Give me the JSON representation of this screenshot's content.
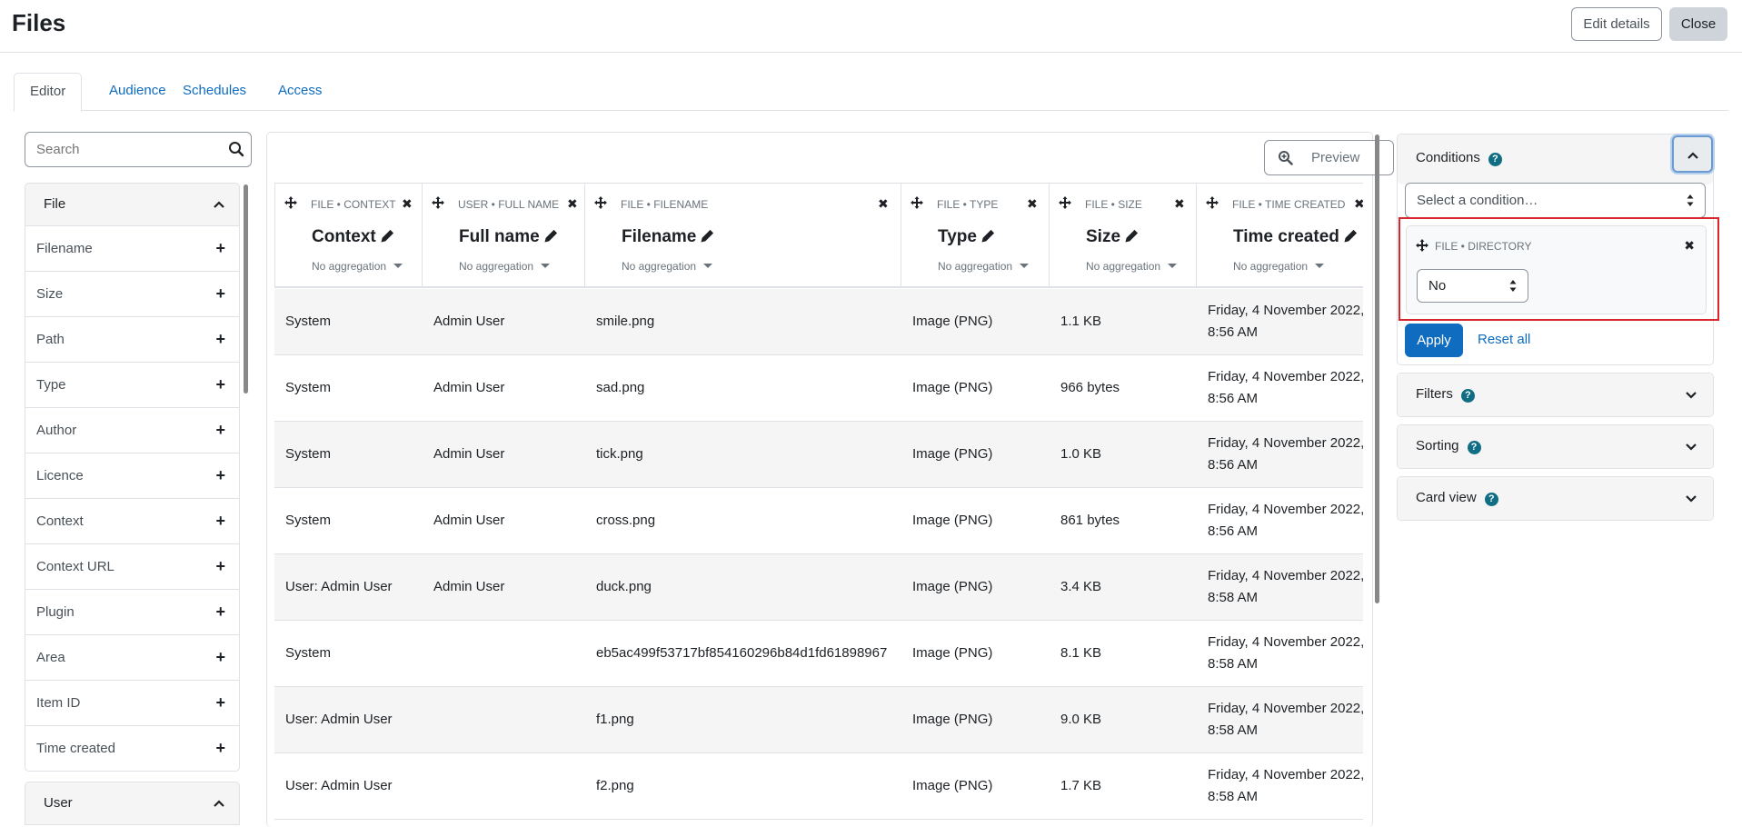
{
  "header": {
    "title": "Files",
    "edit_details_label": "Edit details",
    "close_label": "Close"
  },
  "tabs": [
    {
      "label": "Editor",
      "active": true
    },
    {
      "label": "Audience",
      "active": false
    },
    {
      "label": "Schedules",
      "active": false
    },
    {
      "label": "Access",
      "active": false
    }
  ],
  "sidebar": {
    "search_placeholder": "Search",
    "groups": [
      {
        "label": "File",
        "items": [
          "Filename",
          "Size",
          "Path",
          "Type",
          "Author",
          "Licence",
          "Context",
          "Context URL",
          "Plugin",
          "Area",
          "Item ID",
          "Time created"
        ]
      },
      {
        "label": "User",
        "items": []
      }
    ]
  },
  "main": {
    "preview_label": "Preview",
    "columns": [
      {
        "meta": "FILE • CONTEXT",
        "title": "Context",
        "aggregation": "No aggregation"
      },
      {
        "meta": "USER • FULL NAME",
        "title": "Full name",
        "aggregation": "No aggregation"
      },
      {
        "meta": "FILE • FILENAME",
        "title": "Filename",
        "aggregation": "No aggregation"
      },
      {
        "meta": "FILE • TYPE",
        "title": "Type",
        "aggregation": "No aggregation"
      },
      {
        "meta": "FILE • SIZE",
        "title": "Size",
        "aggregation": "No aggregation"
      },
      {
        "meta": "FILE • TIME CREATED",
        "title": "Time created",
        "aggregation": "No aggregation"
      }
    ],
    "rows": [
      [
        "System",
        "Admin User",
        "smile.png",
        "Image (PNG)",
        "1.1 KB",
        "Friday, 4 November 2022,",
        "8:56 AM"
      ],
      [
        "System",
        "Admin User",
        "sad.png",
        "Image (PNG)",
        "966 bytes",
        "Friday, 4 November 2022,",
        "8:56 AM"
      ],
      [
        "System",
        "Admin User",
        "tick.png",
        "Image (PNG)",
        "1.0 KB",
        "Friday, 4 November 2022,",
        "8:56 AM"
      ],
      [
        "System",
        "Admin User",
        "cross.png",
        "Image (PNG)",
        "861 bytes",
        "Friday, 4 November 2022,",
        "8:56 AM"
      ],
      [
        "User: Admin User",
        "Admin User",
        "duck.png",
        "Image (PNG)",
        "3.4 KB",
        "Friday, 4 November 2022,",
        "8:58 AM"
      ],
      [
        "System",
        "",
        "eb5ac499f53717bf854160296b84d1fd61898967",
        "Image (PNG)",
        "8.1 KB",
        "Friday, 4 November 2022,",
        "8:58 AM"
      ],
      [
        "User: Admin User",
        "",
        "f1.png",
        "Image (PNG)",
        "9.0 KB",
        "Friday, 4 November 2022,",
        "8:58 AM"
      ],
      [
        "User: Admin User",
        "",
        "f2.png",
        "Image (PNG)",
        "1.7 KB",
        "Friday, 4 November 2022,",
        "8:58 AM"
      ]
    ]
  },
  "conditions": {
    "title": "Conditions",
    "select_placeholder": "Select a condition…",
    "item_meta": "FILE • DIRECTORY",
    "item_value": "No",
    "apply_label": "Apply",
    "reset_label": "Reset all"
  },
  "filters": {
    "title": "Filters"
  },
  "sorting": {
    "title": "Sorting"
  },
  "card_view": {
    "title": "Card view"
  },
  "icons": {
    "search": "search-icon",
    "preview": "zoom-in-icon",
    "move": "move-icon",
    "remove": "close-icon",
    "edit": "pencil-icon",
    "help": "question-circle-icon",
    "chevron_up": "chevron-up-icon",
    "chevron_down": "chevron-down-icon",
    "add": "plus-icon"
  },
  "colors": {
    "link": "#0f6cbf",
    "primary_button": "#0f6cbf",
    "help_icon": "#0f6e84",
    "highlight_border": "#d9262e"
  }
}
